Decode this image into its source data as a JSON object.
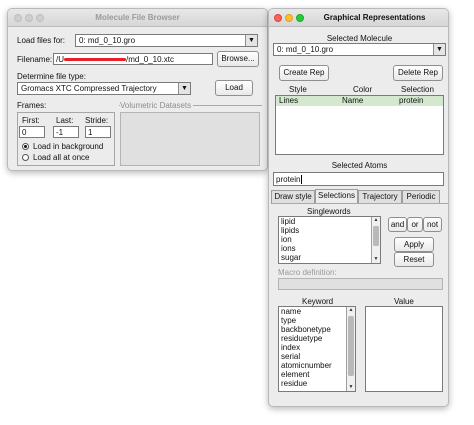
{
  "molecule_file_browser": {
    "title": "Molecule File Browser",
    "load_files_label": "Load files for:",
    "load_files_value": "0: md_0_10.gro",
    "filename_label": "Filename:",
    "filename_prefix": "/U",
    "filename_suffix": "/md_0_10.xtc",
    "browse_label": "Browse...",
    "determine_type_label": "Determine file type:",
    "file_type_value": "Gromacs XTC Compressed Trajectory",
    "load_label": "Load",
    "frames_label": "Frames:",
    "first_label": "First:",
    "last_label": "Last:",
    "stride_label": "Stride:",
    "first_value": "0",
    "last_value": "-1",
    "stride_value": "1",
    "load_background_label": "Load in background",
    "load_all_label": "Load all at once",
    "volumetric_label": "Volumetric Datasets"
  },
  "graphical_representations": {
    "title": "Graphical Representations",
    "selected_molecule_label": "Selected Molecule",
    "selected_molecule_value": "0: md_0_10.gro",
    "create_rep_label": "Create Rep",
    "delete_rep_label": "Delete Rep",
    "columns": [
      "Style",
      "Color",
      "Selection"
    ],
    "rows": [
      {
        "style": "Lines",
        "color": "Name",
        "selection": "protein"
      }
    ],
    "selected_atoms_label": "Selected Atoms",
    "selected_atoms_value": "protein",
    "tabs": [
      "Draw style",
      "Selections",
      "Trajectory",
      "Periodic"
    ],
    "singlewords_label": "Singlewords",
    "singlewords": [
      "lipid",
      "lipids",
      "ion",
      "ions",
      "sugar"
    ],
    "and_label": "and",
    "or_label": "or",
    "not_label": "not",
    "apply_label": "Apply",
    "reset_label": "Reset",
    "macro_definition_label": "Macro definition:",
    "keyword_label": "Keyword",
    "value_label": "Value",
    "keywords": [
      "name",
      "type",
      "backbonetype",
      "residuetype",
      "index",
      "serial",
      "atomicnumber",
      "element",
      "residue"
    ]
  },
  "colors": {
    "window_bg": "#ececec",
    "selected_row": "#d4e8cf",
    "redaction": "#e8202a"
  }
}
